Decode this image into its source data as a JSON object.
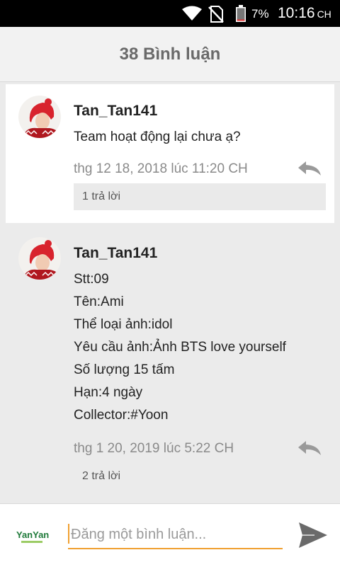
{
  "status_bar": {
    "battery": "7%",
    "time": "10:16",
    "ampm": "CH",
    "icons": [
      "wifi-icon",
      "no-sim-icon",
      "battery-icon"
    ]
  },
  "header": {
    "title": "38 Bình luận"
  },
  "comments": [
    {
      "author": "Tan_Tan141",
      "body": "Team hoạt động lại chưa ạ?",
      "timestamp": "thg 12 18, 2018 lúc 11:20 CH",
      "replies": "1 trả lời"
    },
    {
      "author": "Tan_Tan141",
      "lines": [
        "Stt:09",
        "Tên:Ami",
        "Thể loại ảnh:idol",
        "Yêu cầu ảnh:Ảnh BTS love yourself",
        "Số lượng 15 tấm",
        "Hạn:4 ngày",
        "Collector:#Yoon"
      ],
      "timestamp": "thg 1 20, 2019 lúc 5:22 CH",
      "replies": "2 trả lời"
    }
  ],
  "composer": {
    "placeholder": "Đăng một bình luận...",
    "logo_text": "YanYan"
  },
  "colors": {
    "accent": "#f0a030",
    "header_text": "#6a6a6a",
    "timestamp": "#8a8a8a"
  }
}
